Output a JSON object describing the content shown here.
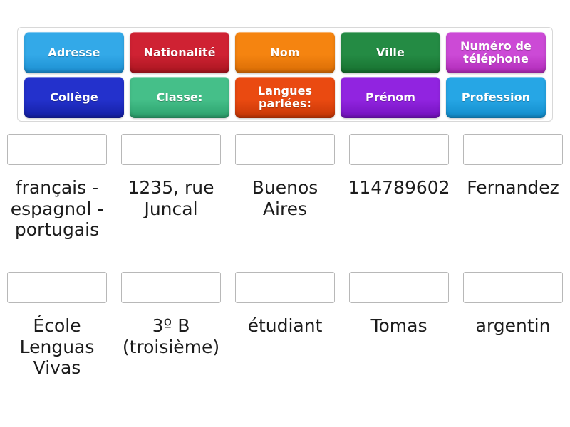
{
  "activity": {
    "type": "match-up-drag-and-drop",
    "language": "fr"
  },
  "tile_bank": {
    "rows": [
      {
        "tiles": [
          {
            "label": "Adresse",
            "color": "#33a9e8",
            "color_dark": "#1b8ed1"
          },
          {
            "label": "Nationalité",
            "color": "#cf2233",
            "color_dark": "#a9151f"
          },
          {
            "label": "Nom",
            "color": "#f58410",
            "color_dark": "#d96c05"
          },
          {
            "label": "Ville",
            "color": "#248b44",
            "color_dark": "#17702f"
          },
          {
            "label": "Numéro de téléphone",
            "color": "#cc4ad6",
            "color_dark": "#b02ab8"
          }
        ]
      },
      {
        "tiles": [
          {
            "label": "Collège",
            "color": "#2331cc",
            "color_dark": "#141fa3"
          },
          {
            "label": "Classe:",
            "color": "#45bf89",
            "color_dark": "#2ba06c"
          },
          {
            "label": "Langues parlées:",
            "color": "#ea4a11",
            "color_dark": "#c53606"
          },
          {
            "label": "Prénom",
            "color": "#9124e0",
            "color_dark": "#7311bd"
          },
          {
            "label": "Profession",
            "color": "#26a6e5",
            "color_dark": "#118ccb"
          }
        ]
      }
    ]
  },
  "answers": {
    "rows": [
      {
        "cells": [
          {
            "drop_placeholder": "",
            "text": "français -\nespagnol -\nportugais"
          },
          {
            "drop_placeholder": "",
            "text": "1235, rue\nJuncal"
          },
          {
            "drop_placeholder": "",
            "text": "Buenos\nAires"
          },
          {
            "drop_placeholder": "",
            "text": "114789602"
          },
          {
            "drop_placeholder": "",
            "text": "Fernandez"
          }
        ]
      },
      {
        "cells": [
          {
            "drop_placeholder": "",
            "text": "École\nLenguas\nVivas"
          },
          {
            "drop_placeholder": "",
            "text": "3º B\n(troisième)"
          },
          {
            "drop_placeholder": "",
            "text": "étudiant"
          },
          {
            "drop_placeholder": "",
            "text": "Tomas"
          },
          {
            "drop_placeholder": "",
            "text": "argentin"
          }
        ]
      }
    ]
  },
  "colors": {
    "page_background": "#ffffff",
    "bank_border": "#d8d8d8",
    "drop_zone_border": "#b8b8b8",
    "answer_text": "#1c1c1c"
  }
}
